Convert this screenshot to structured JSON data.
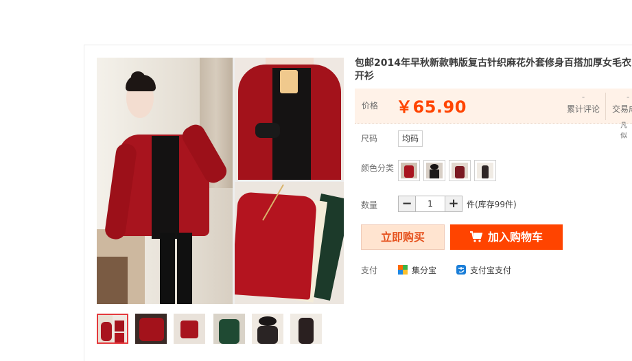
{
  "product": {
    "title": "包邮2014年早秋新款韩版复古针织麻花外套修身百搭加厚女毛衣开衫",
    "price_label": "价格",
    "price": "￥65.90",
    "stats": [
      {
        "value": "-",
        "label": "累计评论"
      },
      {
        "value": "-",
        "label": "交易成"
      }
    ],
    "stats_overflow": "凡似"
  },
  "options": {
    "size_label": "尺码",
    "size_value": "均码",
    "color_label": "颜色分类",
    "qty_label": "数量",
    "qty_minus": "−",
    "qty_value": "1",
    "qty_plus": "+",
    "stock": "件(库存99件)"
  },
  "actions": {
    "buy_now": "立即购买",
    "add_cart": "加入购物车"
  },
  "payment": {
    "label": "支付",
    "methods": [
      "集分宝",
      "支付宝支付"
    ]
  },
  "colors": {
    "accent": "#ff4400",
    "price": "#ff4400",
    "price_bg": "#fff2e8",
    "sweater_red": "#a8141e"
  }
}
